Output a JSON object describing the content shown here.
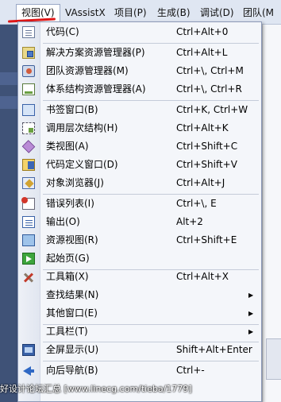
{
  "menubar": {
    "items": [
      "视图(V)",
      "VAssistX",
      "项目(P)",
      "生成(B)",
      "调试(D)",
      "团队(M"
    ],
    "active_index": 0
  },
  "view_menu": {
    "items": [
      {
        "label": "代码(C)",
        "shortcut": "Ctrl+Alt+0",
        "icon": "code-file-icon"
      },
      {
        "label": "解决方案资源管理器(P)",
        "shortcut": "Ctrl+Alt+L",
        "icon": "solution-explorer-icon"
      },
      {
        "label": "团队资源管理器(M)",
        "shortcut": "Ctrl+\\, Ctrl+M",
        "icon": "team-explorer-icon"
      },
      {
        "label": "体系结构资源管理器(A)",
        "shortcut": "Ctrl+\\, Ctrl+R",
        "icon": "architecture-explorer-icon"
      },
      {
        "label": "书签窗口(B)",
        "shortcut": "Ctrl+K, Ctrl+W",
        "icon": "bookmark-window-icon"
      },
      {
        "label": "调用层次结构(H)",
        "shortcut": "Ctrl+Alt+K",
        "icon": "call-hierarchy-icon"
      },
      {
        "label": "类视图(A)",
        "shortcut": "Ctrl+Shift+C",
        "icon": "class-view-icon"
      },
      {
        "label": "代码定义窗口(D)",
        "shortcut": "Ctrl+Shift+V",
        "icon": "code-definition-icon"
      },
      {
        "label": "对象浏览器(J)",
        "shortcut": "Ctrl+Alt+J",
        "icon": "object-browser-icon"
      },
      {
        "label": "错误列表(I)",
        "shortcut": "Ctrl+\\, E",
        "icon": "error-list-icon"
      },
      {
        "label": "输出(O)",
        "shortcut": "Alt+2",
        "icon": "output-icon"
      },
      {
        "label": "资源视图(R)",
        "shortcut": "Ctrl+Shift+E",
        "icon": "resource-view-icon"
      },
      {
        "label": "起始页(G)",
        "shortcut": "",
        "icon": "start-page-icon"
      },
      {
        "label": "工具箱(X)",
        "shortcut": "Ctrl+Alt+X",
        "icon": "toolbox-icon"
      },
      {
        "label": "查找结果(N)",
        "shortcut": "",
        "icon": ""
      },
      {
        "label": "其他窗口(E)",
        "shortcut": "",
        "icon": ""
      },
      {
        "label": "工具栏(T)",
        "shortcut": "",
        "icon": ""
      },
      {
        "label": "全屏显示(U)",
        "shortcut": "Shift+Alt+Enter",
        "icon": "full-screen-icon"
      },
      {
        "label": "向后导航(B)",
        "shortcut": "Ctrl+-",
        "icon": "navigate-back-icon"
      }
    ]
  },
  "watermark": "好设计论坛汇总 [www.linecg.com/tieba/1779]",
  "colors": {
    "highlight_underline": "#e01818",
    "menu_background": "#f4f6fa",
    "menu_border": "#8d9ab8"
  }
}
